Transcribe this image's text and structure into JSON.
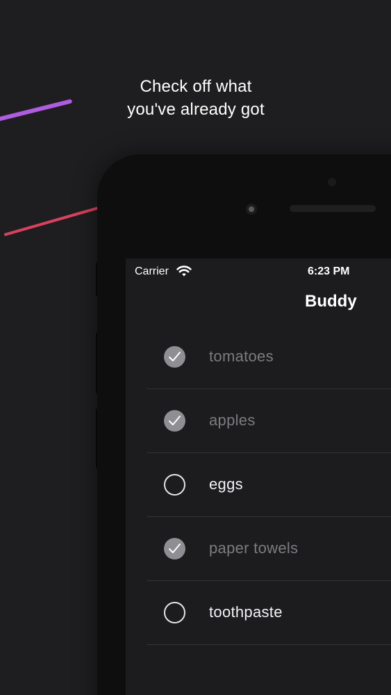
{
  "headline": {
    "line1": "Check off what",
    "line2": "you've already got"
  },
  "status_bar": {
    "carrier": "Carrier",
    "time": "6:23 PM",
    "icon": "wifi-icon"
  },
  "nav": {
    "title": "Buddy"
  },
  "items": [
    {
      "label": "tomatoes",
      "checked": true
    },
    {
      "label": "apples",
      "checked": true
    },
    {
      "label": "eggs",
      "checked": false
    },
    {
      "label": "paper towels",
      "checked": true
    },
    {
      "label": "toothpaste",
      "checked": false
    }
  ],
  "colors": {
    "background": "#1e1e20",
    "accent_purple": "#b05ce0",
    "accent_red": "#d9415e",
    "checked_fill": "#8e8e93",
    "checked_text": "#7c7c80"
  }
}
